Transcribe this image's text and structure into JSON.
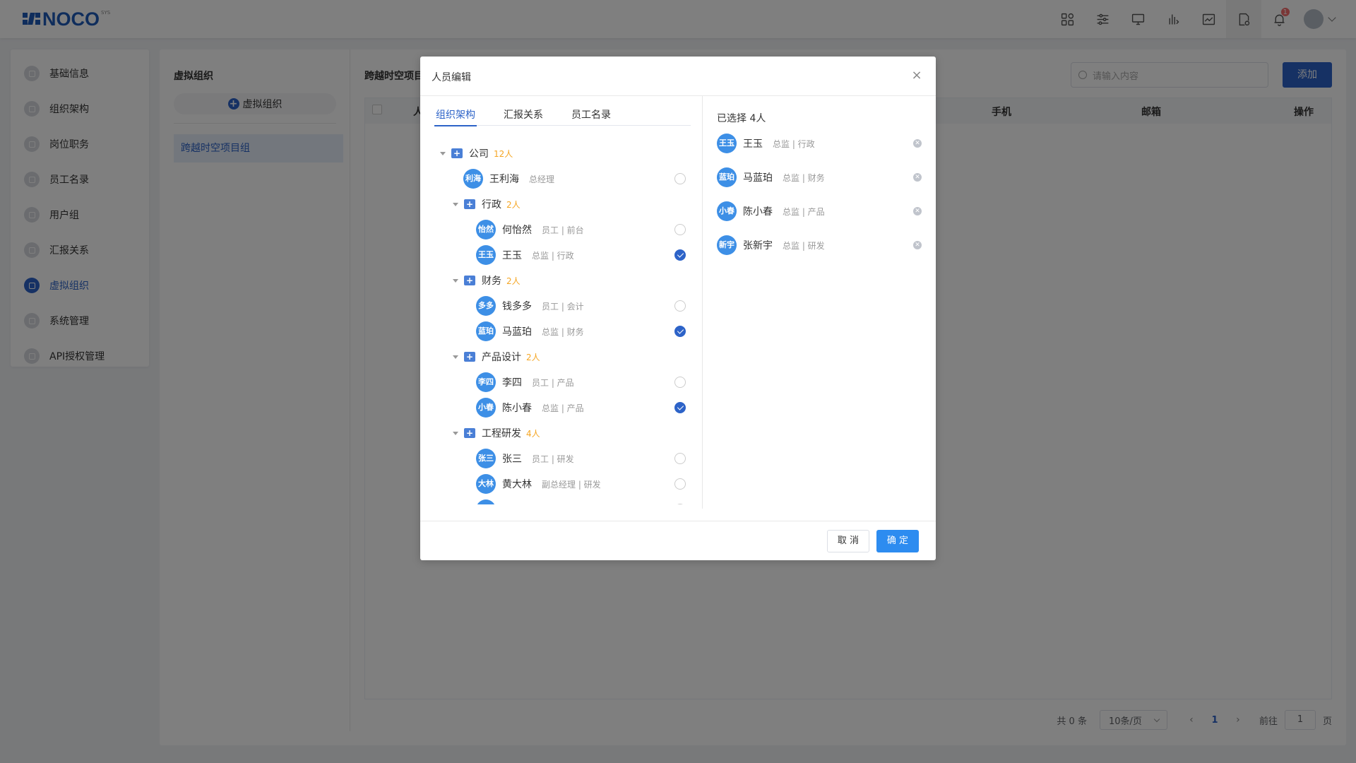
{
  "header": {
    "logo_text": "NOCO",
    "logo_sup": "SYS",
    "notification_count": "1",
    "icons": [
      "apps-icon",
      "sliders-icon",
      "monitor-icon",
      "chart-icon",
      "image-chart-icon",
      "doc-settings-icon",
      "bell-icon"
    ]
  },
  "sidebar": {
    "items": [
      {
        "label": "基础信息",
        "active": false
      },
      {
        "label": "组织架构",
        "active": false
      },
      {
        "label": "岗位职务",
        "active": false
      },
      {
        "label": "员工名录",
        "active": false
      },
      {
        "label": "用户组",
        "active": false
      },
      {
        "label": "汇报关系",
        "active": false
      },
      {
        "label": "虚拟组织",
        "active": true
      },
      {
        "label": "系统管理",
        "active": false
      },
      {
        "label": "API授权管理",
        "active": false
      }
    ]
  },
  "virtual_org": {
    "title": "虚拟组织",
    "add_label": "虚拟组织",
    "selected_item": "跨越时空项目组"
  },
  "content": {
    "title": "跨越时空项目组",
    "search_placeholder": "请输入内容",
    "add_button": "添加",
    "columns": {
      "name": "人",
      "phone": "手机",
      "email": "邮箱",
      "action": "操作"
    },
    "pager": {
      "total": "共 0 条",
      "page_size": "10条/页",
      "prev": "‹",
      "next": "›",
      "current": "1",
      "goto_label": "前往",
      "goto_value": "1",
      "page_suffix": "页"
    }
  },
  "modal": {
    "title": "人员编辑",
    "close": "×",
    "tabs": [
      "组织架构",
      "汇报关系",
      "员工名录"
    ],
    "tree": {
      "root": {
        "name": "公司",
        "count": "12人"
      },
      "root_person": {
        "avatar": "利海",
        "name": "王利海",
        "role": "总经理",
        "checked": false
      },
      "departments": [
        {
          "name": "行政",
          "count": "2人",
          "members": [
            {
              "avatar": "怡然",
              "name": "何怡然",
              "role": "员工 | 前台",
              "checked": false
            },
            {
              "avatar": "王玉",
              "name": "王玉",
              "role": "总监 | 行政",
              "checked": true
            }
          ]
        },
        {
          "name": "财务",
          "count": "2人",
          "members": [
            {
              "avatar": "多多",
              "name": "钱多多",
              "role": "员工 | 会计",
              "checked": false
            },
            {
              "avatar": "蓝珀",
              "name": "马蓝珀",
              "role": "总监 | 财务",
              "checked": true
            }
          ]
        },
        {
          "name": "产品设计",
          "count": "2人",
          "members": [
            {
              "avatar": "李四",
              "name": "李四",
              "role": "员工 | 产品",
              "checked": false
            },
            {
              "avatar": "小春",
              "name": "陈小春",
              "role": "总监 | 产品",
              "checked": true
            }
          ]
        },
        {
          "name": "工程研发",
          "count": "4人",
          "members": [
            {
              "avatar": "张三",
              "name": "张三",
              "role": "员工 | 研发",
              "checked": false
            },
            {
              "avatar": "大林",
              "name": "黄大林",
              "role": "副总经理 | 研发",
              "checked": false
            },
            {
              "avatar": "",
              "name": "",
              "role": "",
              "checked": false
            }
          ]
        }
      ]
    },
    "selected_title": "已选择 4人",
    "selected": [
      {
        "avatar": "王玉",
        "name": "王玉",
        "role": "总监 | 行政"
      },
      {
        "avatar": "蓝珀",
        "name": "马蓝珀",
        "role": "总监 | 财务"
      },
      {
        "avatar": "小春",
        "name": "陈小春",
        "role": "总监 | 产品"
      },
      {
        "avatar": "新宇",
        "name": "张新宇",
        "role": "总监 | 研发"
      }
    ],
    "cancel": "取 消",
    "confirm": "确 定"
  },
  "colors": {
    "primary": "#2d63c8",
    "avatar": "#3d8fe6",
    "count": "#f5a623",
    "ok_button": "#2d8cf0"
  }
}
